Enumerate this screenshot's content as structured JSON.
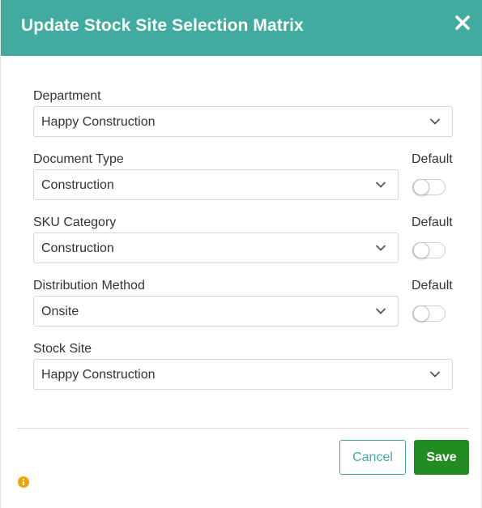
{
  "dialog": {
    "title": "Update Stock Site Selection Matrix",
    "close_icon": "close-icon"
  },
  "form": {
    "department": {
      "label": "Department",
      "value": "Happy Construction"
    },
    "document_type": {
      "label": "Document Type",
      "value": "Construction",
      "default_label": "Default",
      "default_on": false
    },
    "sku_category": {
      "label": "SKU Category",
      "value": "Construction",
      "default_label": "Default",
      "default_on": false
    },
    "distribution_method": {
      "label": "Distribution Method",
      "value": "Onsite",
      "default_label": "Default",
      "default_on": false
    },
    "stock_site": {
      "label": "Stock Site",
      "value": "Happy Construction"
    }
  },
  "footer": {
    "cancel_label": "Cancel",
    "save_label": "Save",
    "info_icon": "info-icon"
  },
  "colors": {
    "header": "#42aba0",
    "save": "#228b22",
    "info": "#f0a400"
  }
}
